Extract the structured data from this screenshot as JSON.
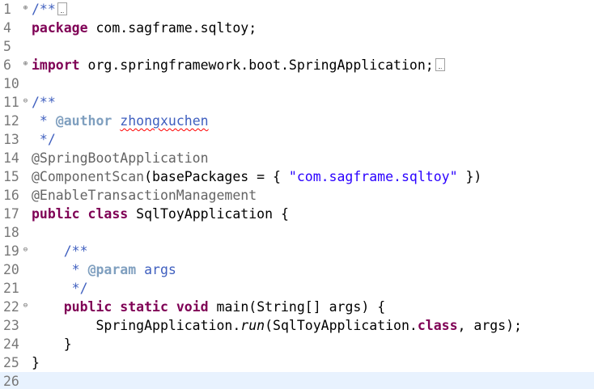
{
  "editor": {
    "lines": [
      {
        "num": "1",
        "fold": "⊕",
        "tokens": [
          [
            "cm",
            "/**"
          ]
        ],
        "collapsed": true
      },
      {
        "num": "4",
        "fold": "",
        "tokens": [
          [
            "kw",
            "package"
          ],
          [
            "",
            " com.sagframe.sqltoy;"
          ]
        ]
      },
      {
        "num": "5",
        "fold": "",
        "tokens": []
      },
      {
        "num": "6",
        "fold": "⊕",
        "tokens": [
          [
            "kw",
            "import"
          ],
          [
            "",
            " org.springframework.boot.SpringApplication;"
          ]
        ],
        "collapsed": true
      },
      {
        "num": "10",
        "fold": "",
        "tokens": []
      },
      {
        "num": "11",
        "fold": "⊖",
        "tokens": [
          [
            "cm",
            "/**"
          ]
        ]
      },
      {
        "num": "12",
        "fold": "",
        "tokens": [
          [
            "cm",
            " * "
          ],
          [
            "cmtag",
            "@author"
          ],
          [
            "cm",
            " "
          ],
          [
            "cm squiggle",
            "zhongxuchen"
          ]
        ]
      },
      {
        "num": "13",
        "fold": "",
        "tokens": [
          [
            "cm",
            " */"
          ]
        ]
      },
      {
        "num": "14",
        "fold": "",
        "tokens": [
          [
            "ann",
            "@SpringBootApplication"
          ]
        ]
      },
      {
        "num": "15",
        "fold": "",
        "tokens": [
          [
            "ann",
            "@ComponentScan"
          ],
          [
            "",
            "(basePackages = { "
          ],
          [
            "str",
            "\"com.sagframe.sqltoy\""
          ],
          [
            "",
            " })"
          ]
        ]
      },
      {
        "num": "16",
        "fold": "",
        "tokens": [
          [
            "ann",
            "@EnableTransactionManagement"
          ]
        ]
      },
      {
        "num": "17",
        "fold": "",
        "tokens": [
          [
            "kw",
            "public"
          ],
          [
            "",
            " "
          ],
          [
            "kw",
            "class"
          ],
          [
            "",
            " SqlToyApplication {"
          ]
        ]
      },
      {
        "num": "18",
        "fold": "",
        "tokens": []
      },
      {
        "num": "19",
        "fold": "⊖",
        "tokens": [
          [
            "",
            "    "
          ],
          [
            "cm",
            "/**"
          ]
        ]
      },
      {
        "num": "20",
        "fold": "",
        "tokens": [
          [
            "",
            "    "
          ],
          [
            "cm",
            " * "
          ],
          [
            "cmtag",
            "@param"
          ],
          [
            "cm",
            " args"
          ]
        ]
      },
      {
        "num": "21",
        "fold": "",
        "tokens": [
          [
            "",
            "    "
          ],
          [
            "cm",
            " */"
          ]
        ]
      },
      {
        "num": "22",
        "fold": "⊖",
        "tokens": [
          [
            "",
            "    "
          ],
          [
            "kw",
            "public"
          ],
          [
            "",
            " "
          ],
          [
            "kw",
            "static"
          ],
          [
            "",
            " "
          ],
          [
            "kw",
            "void"
          ],
          [
            "",
            " main(String[] args) {"
          ]
        ]
      },
      {
        "num": "23",
        "fold": "",
        "tokens": [
          [
            "",
            "        SpringApplication."
          ],
          [
            "it",
            "run"
          ],
          [
            "",
            "(SqlToyApplication."
          ],
          [
            "kw",
            "class"
          ],
          [
            "",
            ", args);"
          ]
        ]
      },
      {
        "num": "24",
        "fold": "",
        "tokens": [
          [
            "",
            "    }"
          ]
        ]
      },
      {
        "num": "25",
        "fold": "",
        "tokens": [
          [
            "",
            "}"
          ]
        ]
      },
      {
        "num": "26",
        "fold": "",
        "tokens": [],
        "current": true
      }
    ]
  }
}
